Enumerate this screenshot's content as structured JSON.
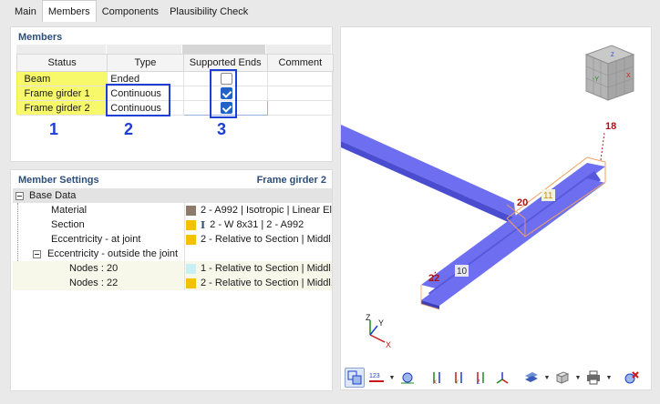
{
  "tabs": [
    "Main",
    "Members",
    "Components",
    "Plausibility Check"
  ],
  "active_tab": 1,
  "members": {
    "title": "Members",
    "columns": [
      "Status",
      "Type",
      "Supported Ends",
      "Comment"
    ],
    "rows": [
      {
        "status": "Beam",
        "type": "Ended",
        "supported": false,
        "comment": ""
      },
      {
        "status": "Frame girder 1",
        "type": "Continuous",
        "supported": true,
        "comment": ""
      },
      {
        "status": "Frame girder 2",
        "type": "Continuous",
        "supported": true,
        "comment": ""
      }
    ],
    "annotations": [
      "1",
      "2",
      "3"
    ]
  },
  "settings": {
    "title": "Member Settings",
    "selected": "Frame girder 2",
    "group": "Base Data",
    "rows": [
      {
        "label": "Material",
        "value": "2 - A992 | Isotropic | Linear El...",
        "color": "#8c7a6a"
      },
      {
        "label": "Section",
        "value": "2 - W 8x31 | 2 - A992",
        "color": "#f2c200",
        "icon": "I"
      },
      {
        "label": "Eccentricity - at joint",
        "value": "2 - Relative to Section | Middl...",
        "color": "#f2c200"
      }
    ],
    "subgroup": "Eccentricity - outside the joint",
    "subrows": [
      {
        "label": "Nodes : 20",
        "value": "1 - Relative to Section | Middl...",
        "color": "#c8f0f4"
      },
      {
        "label": "Nodes : 22",
        "value": "2 - Relative to Section | Middl...",
        "color": "#f2c200"
      }
    ]
  },
  "view3d": {
    "node_labels": [
      "18",
      "20",
      "22"
    ],
    "member_labels": [
      "11",
      "10"
    ],
    "axes": [
      "Z",
      "Y",
      "X"
    ],
    "cube_faces": [
      "-Y",
      "X",
      "Z"
    ],
    "colors": {
      "member": "#6d6ff0",
      "member_dark": "#4547c9",
      "node": "#b01010",
      "accent": "#1c3fd6"
    }
  },
  "toolbar": [
    "view-select-icon",
    "numbering-icon",
    "render-icon",
    "view-x-icon",
    "view-y-icon",
    "view-z-icon",
    "view-iso-icon",
    "display-icon",
    "box-icon",
    "print-icon",
    "close-view-icon"
  ]
}
